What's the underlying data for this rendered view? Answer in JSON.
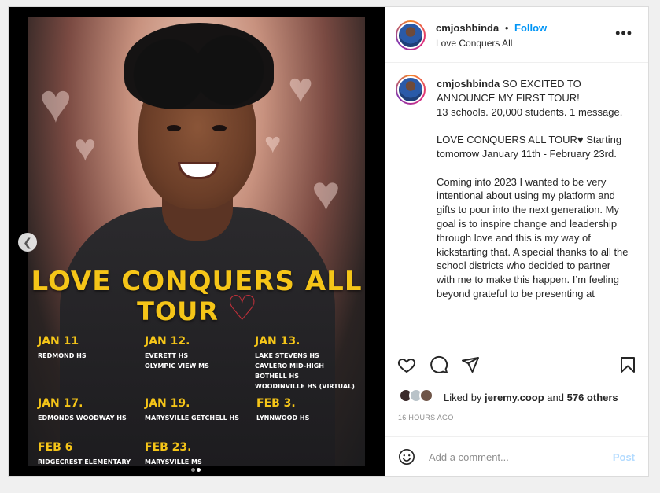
{
  "post": {
    "username": "cmjoshbinda",
    "follow_label": "Follow",
    "separator": "•",
    "location": "Love Conquers All",
    "more_label": "•••",
    "caption_html_text": "SO EXCITED TO ANNOUNCE MY FIRST TOUR!\n13 schools. 20,000 students. 1 message.\n\nLOVE CONQUERS ALL TOUR♥ Starting tomorrow January 11th - February 23rd.\n\nComing into 2023 I wanted to be very intentional about using my platform and gifts to pour into the next generation. My goal is to inspire change and leadership through love and this is my way of kickstarting that. A special thanks to all the school districts who decided to partner with me to make this happen. I’m feeling beyond grateful to be presenting at",
    "liked_by_prefix": "Liked by",
    "liked_by_user": "jeremy.coop",
    "liked_by_and": "and",
    "liked_by_others": "576 others",
    "timestamp": "16 HOURS AGO",
    "comment_placeholder": "Add a comment...",
    "post_label": "Post"
  },
  "poster": {
    "title_line1": "LOVE CONQUERS ALL",
    "title_line2": "TOUR",
    "stops": [
      {
        "date": "JAN 11",
        "schools": [
          "REDMOND HS"
        ]
      },
      {
        "date": "JAN 12.",
        "schools": [
          "EVERETT HS",
          "OLYMPIC VIEW MS"
        ]
      },
      {
        "date": "JAN 13.",
        "schools": [
          "LAKE STEVENS HS",
          "CAVLERO MID-HIGH",
          "BOTHELL HS",
          "WOODINVILLE HS (VIRTUAL)"
        ]
      },
      {
        "date": "JAN 17.",
        "schools": [
          "EDMONDS WOODWAY HS"
        ]
      },
      {
        "date": "JAN 19.",
        "schools": [
          "MARYSVILLE GETCHELL HS"
        ]
      },
      {
        "date": "FEB 3.",
        "schools": [
          "LYNNWOOD HS"
        ]
      },
      {
        "date": "FEB 6",
        "schools": [
          "RIDGECREST ELEMENTARY"
        ]
      },
      {
        "date": "FEB 23.",
        "schools": [
          "MARYSVILLE MS"
        ]
      }
    ],
    "carousel_index": 2,
    "carousel_total": 2
  },
  "colors": {
    "accent": "#0095f6",
    "poster_gold": "#f5c518",
    "poster_heart": "#c0303a"
  }
}
